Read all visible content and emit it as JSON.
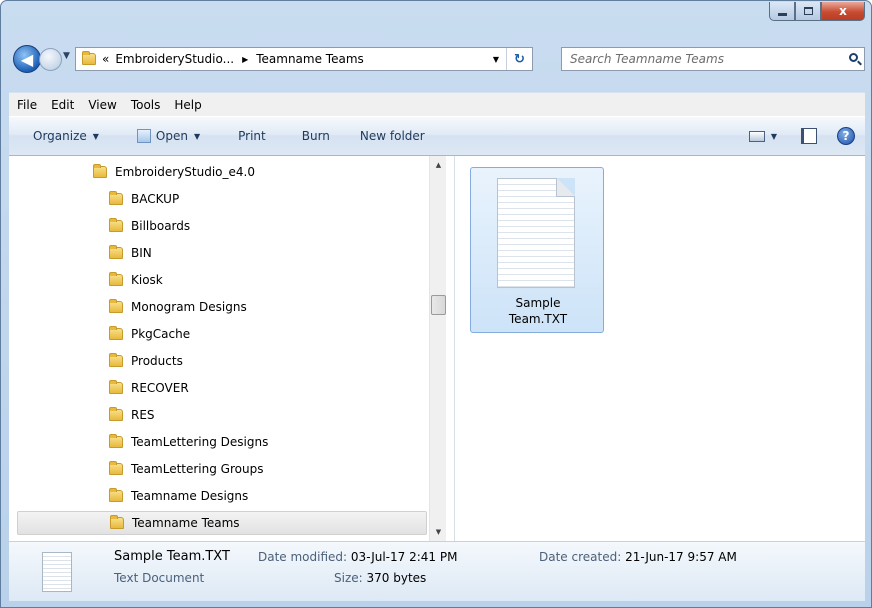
{
  "window": {
    "caption_buttons": {
      "minimize": "minimize",
      "maximize": "maximize",
      "close": "x"
    }
  },
  "nav": {
    "back_glyph": "◀",
    "history_glyph": "▼",
    "address": {
      "crumb_prefix": "«",
      "crumbs": [
        "EmbroideryStudio...",
        "Teamname Teams"
      ],
      "separator": "▶",
      "dropdown_glyph": "▼",
      "refresh_glyph": "↻"
    },
    "search": {
      "placeholder": "Search Teamname Teams"
    }
  },
  "menubar": {
    "items": [
      "File",
      "Edit",
      "View",
      "Tools",
      "Help"
    ]
  },
  "commandbar": {
    "organize": "Organize",
    "open": "Open",
    "print": "Print",
    "burn": "Burn",
    "new_folder": "New folder",
    "dropdown_glyph": "▼",
    "help_glyph": "?"
  },
  "tree": {
    "parent": "EmbroideryStudio_e4.0",
    "children": [
      "BACKUP",
      "Billboards",
      "BIN",
      "Kiosk",
      "Monogram Designs",
      "PkgCache",
      "Products",
      "RECOVER",
      "RES",
      "TeamLettering Designs",
      "TeamLettering Groups",
      "Teamname Designs",
      "Teamname Teams"
    ],
    "selected": "Teamname Teams",
    "scroll_up_glyph": "▲",
    "scroll_down_glyph": "▼"
  },
  "files": [
    {
      "name_line1": "Sample",
      "name_line2": "Team.TXT",
      "icon": "text-document-icon"
    }
  ],
  "details": {
    "title": "Sample Team.TXT",
    "type": "Text Document",
    "modified_label": "Date modified:",
    "modified_value": "03-Jul-17 2:41 PM",
    "size_label": "Size:",
    "size_value": "370 bytes",
    "created_label": "Date created:",
    "created_value": "21-Jun-17 9:57 AM"
  }
}
